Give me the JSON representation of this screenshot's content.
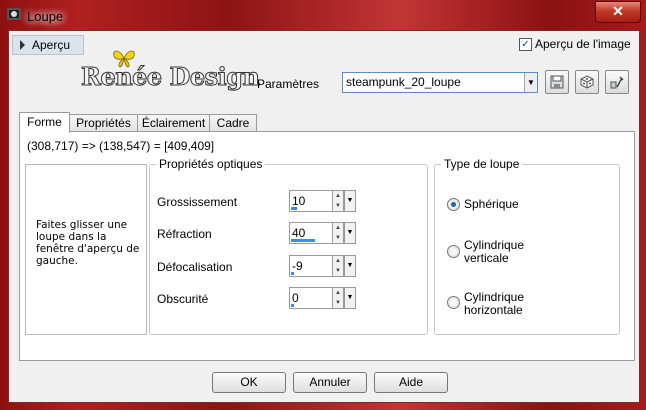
{
  "window": {
    "title": "Loupe",
    "close_label": "✕",
    "frame_color": "#9e1a1a"
  },
  "top": {
    "apercu_label": "Aperçu",
    "preview_label": "Aperçu de l'image",
    "preview_checked": true,
    "logo_text": "Renée Design",
    "params_label": "Paramètres",
    "preset_value": "steampunk_20_loupe"
  },
  "tabs": [
    {
      "label": "Forme",
      "active": true
    },
    {
      "label": "Propriétés",
      "active": false
    },
    {
      "label": "Éclairement",
      "active": false
    },
    {
      "label": "Cadre",
      "active": false
    }
  ],
  "panel": {
    "coords": "(308,717) => (138,547) = [409,409]",
    "instruction": "Faites glisser une loupe dans la fenêtre d'aperçu de gauche."
  },
  "optical": {
    "title": "Propriétés optiques",
    "fields": [
      {
        "label": "Grossissement",
        "value": "10",
        "level": 0.1
      },
      {
        "label": "Réfraction",
        "value": "40",
        "level": 0.4
      },
      {
        "label": "Défocalisation",
        "value": "-9",
        "level": 0.0
      },
      {
        "label": "Obscurité",
        "value": "0",
        "level": 0.0
      }
    ]
  },
  "loupe_type": {
    "title": "Type de loupe",
    "options": [
      {
        "label": "Sphérique",
        "selected": true
      },
      {
        "label": "Cylindrique\nverticale",
        "selected": false
      },
      {
        "label": "Cylindrique\nhorizontale",
        "selected": false
      }
    ]
  },
  "buttons": {
    "ok": "OK",
    "cancel": "Annuler",
    "help": "Aide"
  },
  "colors": {
    "accent": "#3a8ee6"
  }
}
